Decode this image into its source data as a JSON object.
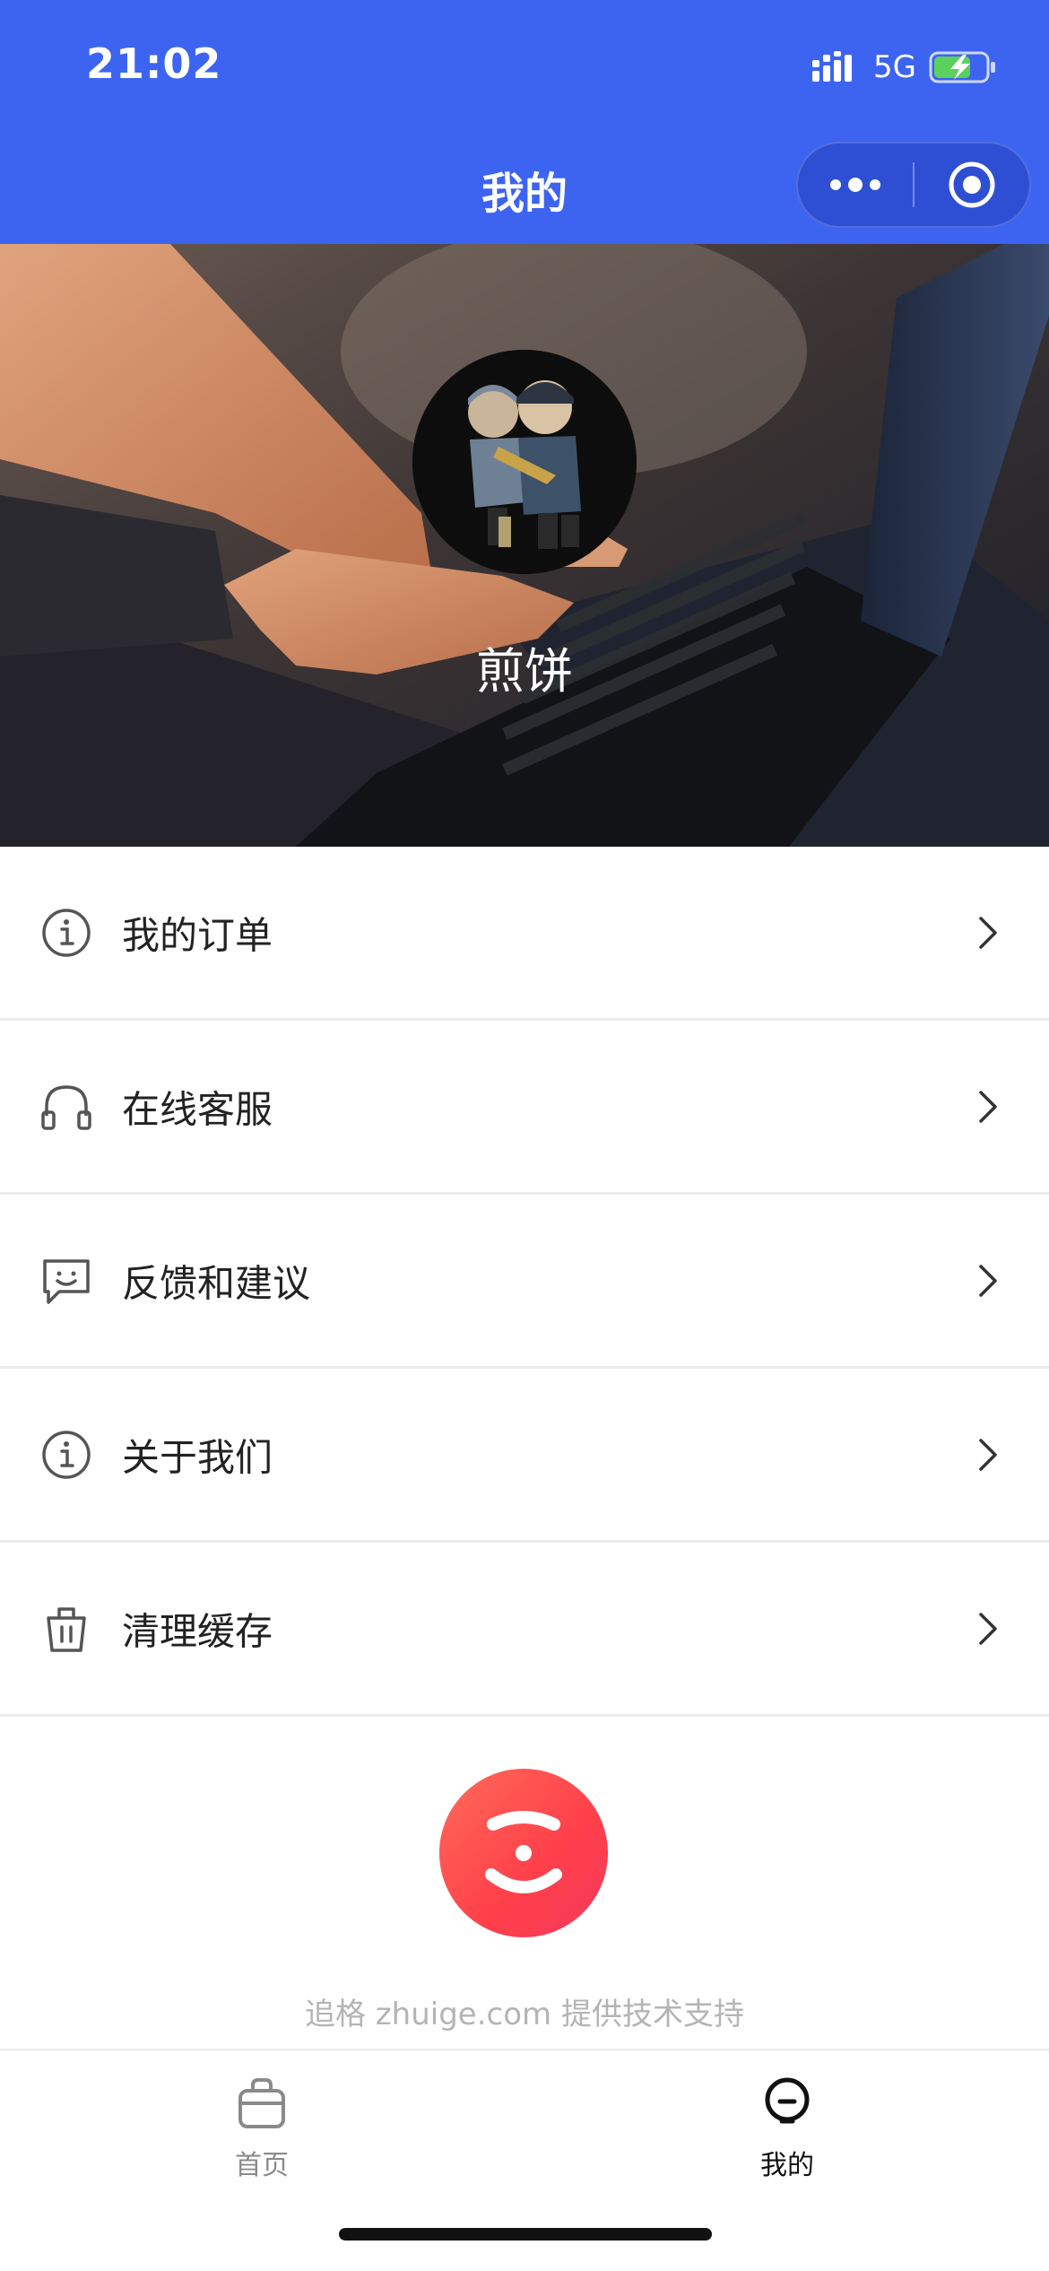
{
  "status_bar": {
    "time": "21:02",
    "network": "5G",
    "icons": [
      "signal-icon",
      "battery-charging-icon"
    ]
  },
  "nav": {
    "title": "我的",
    "background_color": "#3d64f0",
    "capsule_icons": [
      "more-icon",
      "close-miniapp-icon"
    ]
  },
  "profile": {
    "username": "煎饼"
  },
  "menu": {
    "items": [
      {
        "label": "我的订单",
        "icon": "info-icon"
      },
      {
        "label": "在线客服",
        "icon": "headphones-icon"
      },
      {
        "label": "反馈和建议",
        "icon": "feedback-chat-icon"
      },
      {
        "label": "关于我们",
        "icon": "info-icon"
      },
      {
        "label": "清理缓存",
        "icon": "trash-icon"
      }
    ]
  },
  "footer": {
    "support_text": "追格 zhuige.com 提供技术支持"
  },
  "tabbar": {
    "tabs": [
      {
        "label": "首页",
        "icon": "bag-icon",
        "active": false
      },
      {
        "label": "我的",
        "icon": "profile-face-icon",
        "active": true
      }
    ],
    "active_color": "#111111",
    "inactive_color": "#8a8a8a"
  }
}
